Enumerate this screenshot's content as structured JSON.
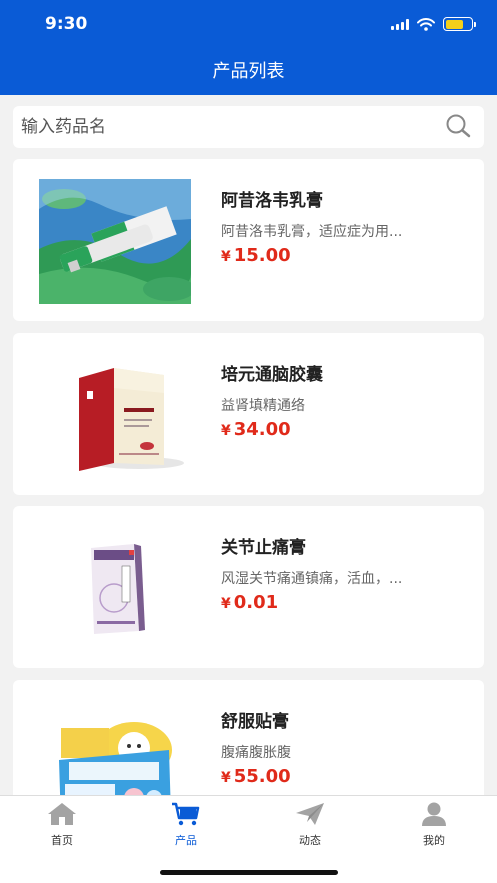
{
  "status_bar": {
    "time": "9:30"
  },
  "header": {
    "title": "产品列表"
  },
  "search": {
    "placeholder": "输入药品名",
    "icon": "search-icon"
  },
  "products": [
    {
      "name": "阿昔洛韦乳膏",
      "desc": "阿昔洛韦乳膏，适应症为用...",
      "currency": "¥",
      "price": "15.00",
      "image": "ointment-tube-box"
    },
    {
      "name": "培元通脑胶囊",
      "desc": "益肾填精通络",
      "currency": "¥",
      "price": "34.00",
      "image": "capsule-box"
    },
    {
      "name": "关节止痛膏",
      "desc": "风湿关节痛通镇痛，活血，...",
      "currency": "¥",
      "price": "0.01",
      "image": "plaster-box"
    },
    {
      "name": "舒服贴膏",
      "desc": "腹痛腹胀腹",
      "currency": "¥",
      "price": "55.00",
      "image": "belly-patch-box"
    }
  ],
  "tabbar": {
    "items": [
      {
        "label": "首页",
        "icon": "home-icon",
        "active": false
      },
      {
        "label": "产品",
        "icon": "cart-icon",
        "active": true
      },
      {
        "label": "动态",
        "icon": "paper-plane-icon",
        "active": false
      },
      {
        "label": "我的",
        "icon": "user-icon",
        "active": false
      }
    ]
  },
  "colors": {
    "brand": "#0a5bd6",
    "price": "#e02a1a",
    "tab_inactive": "#9a9a9a"
  }
}
